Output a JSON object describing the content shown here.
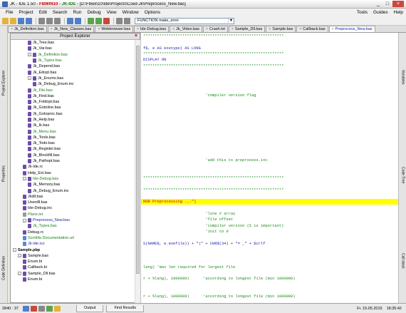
{
  "window": {
    "title_app": "JK - IDE 1.50",
    "title_p1": "FBWIN10",
    "title_p2": "JK-IDE",
    "title_path": "[D:\\Fbwin10\\Ide\\Projects\\Csed-Jk\\Preprocess_New.bas]",
    "min": "_",
    "max": "□",
    "close": "×"
  },
  "menu": {
    "items": [
      "File",
      "Project",
      "Edit",
      "Search",
      "Run",
      "Debug",
      "View",
      "Window",
      "Options"
    ],
    "right": [
      "Tools",
      "Guides",
      "Help"
    ]
  },
  "toolbar": {
    "procedure_select": "FUNCTION make_error",
    "dropdown_arrow": "▼"
  },
  "tabs": [
    {
      "label": "Jk_Definition.bas",
      "active": false
    },
    {
      "label": "Jk_New_Classes.bas",
      "active": false
    },
    {
      "label": "Webbrowser.bas",
      "active": false
    },
    {
      "label": "Ide-Debug.bas",
      "active": false
    },
    {
      "label": "Jk_Video.bas",
      "active": false
    },
    {
      "label": "Crash.txt",
      "active": false
    },
    {
      "label": "Sample_Dll.bas",
      "active": false
    },
    {
      "label": "Sample.bas",
      "active": false
    },
    {
      "label": "Callback.bas",
      "active": false
    },
    {
      "label": "Preprocess_New.bas",
      "active": true
    }
  ],
  "tab_close": "×",
  "left_panels": [
    "Project Explorer",
    "Properties",
    "Code Definition"
  ],
  "right_panels": [
    "Variables",
    "Code Tree",
    "Call stack"
  ],
  "explorer": {
    "title": "Project Explorer",
    "close": "×",
    "rows": [
      {
        "label": "Jk_Tree.bas",
        "indent": 3,
        "kind": "file",
        "style": ""
      },
      {
        "label": "Jk_Var.bas",
        "indent": 3,
        "kind": "file",
        "style": ""
      },
      {
        "label": "Jk_Definition.bas",
        "indent": 3,
        "kind": "file",
        "style": "green",
        "toggle": "-"
      },
      {
        "label": "Jk_Types.bas",
        "indent": 4,
        "kind": "file",
        "style": "green"
      },
      {
        "label": "Jk_Depend.bas",
        "indent": 3,
        "kind": "file",
        "style": ""
      },
      {
        "label": "Jk_Edopt.bas",
        "indent": 3,
        "kind": "file",
        "style": ""
      },
      {
        "label": "Jk_Enums.bas",
        "indent": 3,
        "kind": "file",
        "style": "",
        "toggle": "-"
      },
      {
        "label": "Jk_Debug_Enum.inc",
        "indent": 4,
        "kind": "file",
        "style": ""
      },
      {
        "label": "Jk_File.bas",
        "indent": 3,
        "kind": "file",
        "style": "green"
      },
      {
        "label": "Jk_Find.bas",
        "indent": 3,
        "kind": "file",
        "style": ""
      },
      {
        "label": "Jk_Foldopt.bas",
        "indent": 3,
        "kind": "file",
        "style": ""
      },
      {
        "label": "Jk_Gotoline.bas",
        "indent": 3,
        "kind": "file",
        "style": ""
      },
      {
        "label": "Jk_Gotoproc.bas",
        "indent": 3,
        "kind": "file",
        "style": ""
      },
      {
        "label": "Jk_Help.bas",
        "indent": 3,
        "kind": "file",
        "style": ""
      },
      {
        "label": "Jk_Ik.bas",
        "indent": 3,
        "kind": "file",
        "style": ""
      },
      {
        "label": "Jk_Menu.bas",
        "indent": 3,
        "kind": "file",
        "style": "green"
      },
      {
        "label": "Jk_Tools.bas",
        "indent": 3,
        "kind": "file",
        "style": ""
      },
      {
        "label": "Jk_Todo.bas",
        "indent": 3,
        "kind": "file",
        "style": ""
      },
      {
        "label": "Jk_Register.bas",
        "indent": 3,
        "kind": "file",
        "style": ""
      },
      {
        "label": "Jk_Blockfill.bas",
        "indent": 3,
        "kind": "file",
        "style": ""
      },
      {
        "label": "Jk_Pathopt.bas",
        "indent": 3,
        "kind": "file",
        "style": ""
      },
      {
        "label": "Jk-Ide.rc",
        "indent": 2,
        "kind": "file",
        "style": ""
      },
      {
        "label": "Help_Ext.bas",
        "indent": 2,
        "kind": "file",
        "style": ""
      },
      {
        "label": "Ide-Debug.bas",
        "indent": 2,
        "kind": "file",
        "style": "green",
        "toggle": "-"
      },
      {
        "label": "Jk_Memory.bas",
        "indent": 3,
        "kind": "file",
        "style": ""
      },
      {
        "label": "Jk_Debug_Enum.inc",
        "indent": 3,
        "kind": "file",
        "style": ""
      },
      {
        "label": "Jkdll.bas",
        "indent": 2,
        "kind": "file",
        "style": ""
      },
      {
        "label": "Userdll.bas",
        "indent": 2,
        "kind": "file",
        "style": ""
      },
      {
        "label": "Ide-Debug.inc",
        "indent": 2,
        "kind": "file",
        "style": ""
      },
      {
        "label": "Plans.txt",
        "indent": 2,
        "kind": "txt",
        "style": "green"
      },
      {
        "label": "Preprocess_New.bas",
        "indent": 2,
        "kind": "file",
        "style": "blue",
        "toggle": "-"
      },
      {
        "label": "Jk_Types.bas",
        "indent": 3,
        "kind": "file",
        "style": "green"
      },
      {
        "label": "Debug.rc",
        "indent": 2,
        "kind": "file",
        "style": ""
      },
      {
        "label": "Scintilla Documentation.url",
        "indent": 2,
        "kind": "doc",
        "style": "green"
      },
      {
        "label": "Jk-Ide.ico",
        "indent": 2,
        "kind": "doc",
        "style": "blue"
      },
      {
        "label": "Sample.pbp",
        "indent": 0,
        "kind": "none",
        "style": "bold",
        "toggle": "-"
      },
      {
        "label": "Sample.bas",
        "indent": 1,
        "kind": "file",
        "style": "",
        "toggle": "-"
      },
      {
        "label": "Enum.bi",
        "indent": 2,
        "kind": "file",
        "style": ""
      },
      {
        "label": "Callback.bi",
        "indent": 2,
        "kind": "file",
        "style": ""
      },
      {
        "label": "Sample_Dll.bas",
        "indent": 1,
        "kind": "file",
        "style": "",
        "toggle": "-"
      },
      {
        "label": "Enum.bi",
        "indent": 2,
        "kind": "file",
        "style": ""
      }
    ]
  },
  "editor": {
    "lines": [
      {
        "text": "*************************************************************",
        "row": 0,
        "style": "stars"
      },
      {
        "text": "f$, e AS exetype) AS LONG",
        "row": 2,
        "style": "kw"
      },
      {
        "text": "*************************************************************",
        "row": 3,
        "style": "stars"
      },
      {
        "text": "DISPLAY ON",
        "row": 4,
        "style": "kw"
      },
      {
        "text": "*************************************************************",
        "row": 5,
        "style": "stars"
      },
      {
        "text": "                           'compiler version flag",
        "row": 10,
        "style": "comment"
      },
      {
        "text": "                           'add this to preprocess.inc",
        "row": 21,
        "style": "comment"
      },
      {
        "text": "*************************************************************",
        "row": 24,
        "style": "stars"
      },
      {
        "text": "*************************************************************",
        "row": 26,
        "style": "stars"
      },
      {
        "text": "ROR Preprocessing ...\")",
        "row": 28,
        "style": "red",
        "highlight": true
      },
      {
        "text": "                           'line # array",
        "row": 30,
        "style": "comment"
      },
      {
        "text": "                           'file offset",
        "row": 31,
        "style": "comment"
      },
      {
        "text": "                           'compiler version (5 is important)",
        "row": 32,
        "style": "comment"
      },
      {
        "text": "                           'init to 0",
        "row": 33,
        "style": "comment"
      },
      {
        "text": "S(NAME$, e.exefile)) + \"|\" + CHR$(34) + \"= _\" + $crlf",
        "row": 35,
        "style": "kw"
      },
      {
        "text": "lang) 'max len required for largest file",
        "row": 39,
        "style": "comment"
      },
      {
        "text": "r + %lang), 1000000)      'according to longest file (min 1000000)",
        "row": 41,
        "style": "comment"
      },
      {
        "text": "r + %lang), 1000000)      'according to longest file (min 1000000)",
        "row": 44,
        "style": "comment"
      }
    ]
  },
  "status": {
    "position": "2840 : 37",
    "output_tab": "Output",
    "find_tab": "Find Results",
    "date": "Fr. 15.05.2015",
    "time": "18:35:42"
  }
}
